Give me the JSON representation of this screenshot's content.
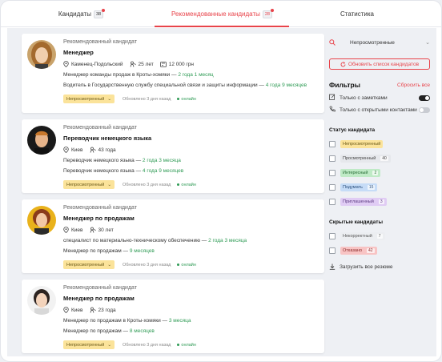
{
  "tabs": [
    {
      "label": "Кандидаты",
      "count": "38"
    },
    {
      "label": "Рекомендованные кандидаты",
      "count": "28"
    },
    {
      "label": "Статистика"
    }
  ],
  "cards": [
    {
      "rec": "Рекомендованный кандидат",
      "title": "Менеджер",
      "city": "Каменец-Подольский",
      "age": "25 лет",
      "salary": "12 000 грн",
      "exp": [
        {
          "text": "Менеджер команды продаж в Кроты-хомяки",
          "dur": "2 года 1 месяц"
        },
        {
          "text": "Водитель в Государственную службу специальной связи и защиты информации",
          "dur": "4 года 9 месяцев"
        }
      ],
      "status": "Непросмотренный",
      "updated": "Обновлено 3 дня назад",
      "online": "онлайн"
    },
    {
      "rec": "Рекомендованный кандидат",
      "title": "Переводчик немецкого языка",
      "city": "Киев",
      "age": "43 года",
      "exp": [
        {
          "text": "Переводчик немецкого языка",
          "dur": "2 года 3 месяца"
        },
        {
          "text": "Переводчик немецкого языка",
          "dur": "4 года 9 месяцев"
        }
      ],
      "status": "Непросмотренный",
      "updated": "Обновлено 3 дня назад",
      "online": "онлайн"
    },
    {
      "rec": "Рекомендованный кандидат",
      "title": "Менеджер по продажам",
      "city": "Киев",
      "age": "30 лет",
      "exp": [
        {
          "text": "специалист по материально-техническому обеспечению",
          "dur": "2 года 3 месяца"
        },
        {
          "text": "Менеджер по продажам",
          "dur": "9 месяцев"
        }
      ],
      "status": "Непросмотренный",
      "updated": "Обновлено 3 дня назад",
      "online": "онлайн"
    },
    {
      "rec": "Рекомендованный кандидат",
      "title": "Менеджер по продажам",
      "city": "Киев",
      "age": "23 года",
      "exp": [
        {
          "text": "Менеджер по продажам в Кроты-хомяки",
          "dur": "3 месяца"
        },
        {
          "text": "Менеджер по продажам",
          "dur": "8 месяцев"
        }
      ],
      "status": "Непросмотренный",
      "updated": "Обновлено 3 дня назад",
      "online": "онлайн"
    }
  ],
  "sidebar": {
    "select": "Непросмотренные",
    "refresh": "Обновить список кандидатов",
    "filters_title": "Фильтры",
    "reset": "Сбросить все",
    "toggle1": "Только с заметками",
    "toggle2": "Только с открытыми контактами",
    "status_title": "Статус кандидата",
    "statuses": [
      {
        "label": "Непросмотренный",
        "count": "",
        "bg": "#fbe39a",
        "fg": "#6b5a19"
      },
      {
        "label": "Просмотренный",
        "count": "40",
        "bg": "#e6e8ec",
        "fg": "#444"
      },
      {
        "label": "Интересный",
        "count": "2",
        "bg": "#bfeac6",
        "fg": "#256b34"
      },
      {
        "label": "Подумать",
        "count": "15",
        "bg": "#c6dcf7",
        "fg": "#2a4f7d"
      },
      {
        "label": "Приглашенный",
        "count": "3",
        "bg": "#e0ccf4",
        "fg": "#5b3a80"
      }
    ],
    "hidden_title": "Скрытые кандидаты",
    "hidden": [
      {
        "label": "Некорректный",
        "count": "7",
        "bg": "#eceef1",
        "fg": "#555"
      },
      {
        "label": "Отказано",
        "count": "42",
        "bg": "#f8c4c4",
        "fg": "#8a2a2a"
      }
    ],
    "download": "Загрузить все резюме"
  }
}
